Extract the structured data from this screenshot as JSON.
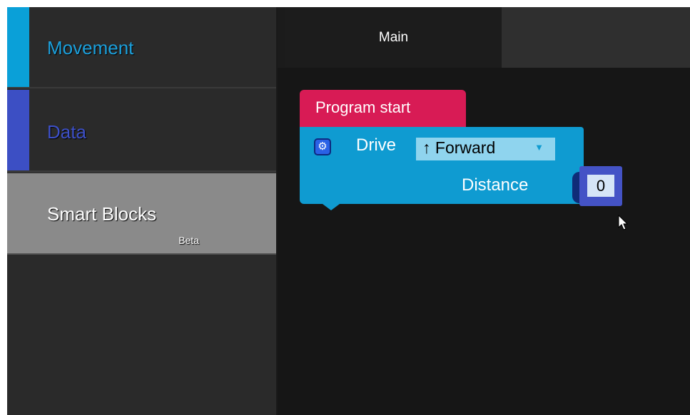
{
  "sidebar": {
    "categories": [
      {
        "label": "Movement",
        "color": "#1ca0dc"
      },
      {
        "label": "Data",
        "color": "#3d50c8"
      },
      {
        "label": "Smart Blocks",
        "sub": "Beta",
        "color": "#8a8a8a"
      }
    ]
  },
  "tabs": [
    {
      "label": "Main",
      "active": true
    }
  ],
  "blocks": {
    "hat": {
      "label": "Program start",
      "color": "#d81b55"
    },
    "drive": {
      "label": "Drive",
      "direction_value": "↑ Forward",
      "distance_label": "Distance",
      "distance_value": "0",
      "color": "#0f9bd1",
      "settings_icon": "gear-icon"
    }
  }
}
